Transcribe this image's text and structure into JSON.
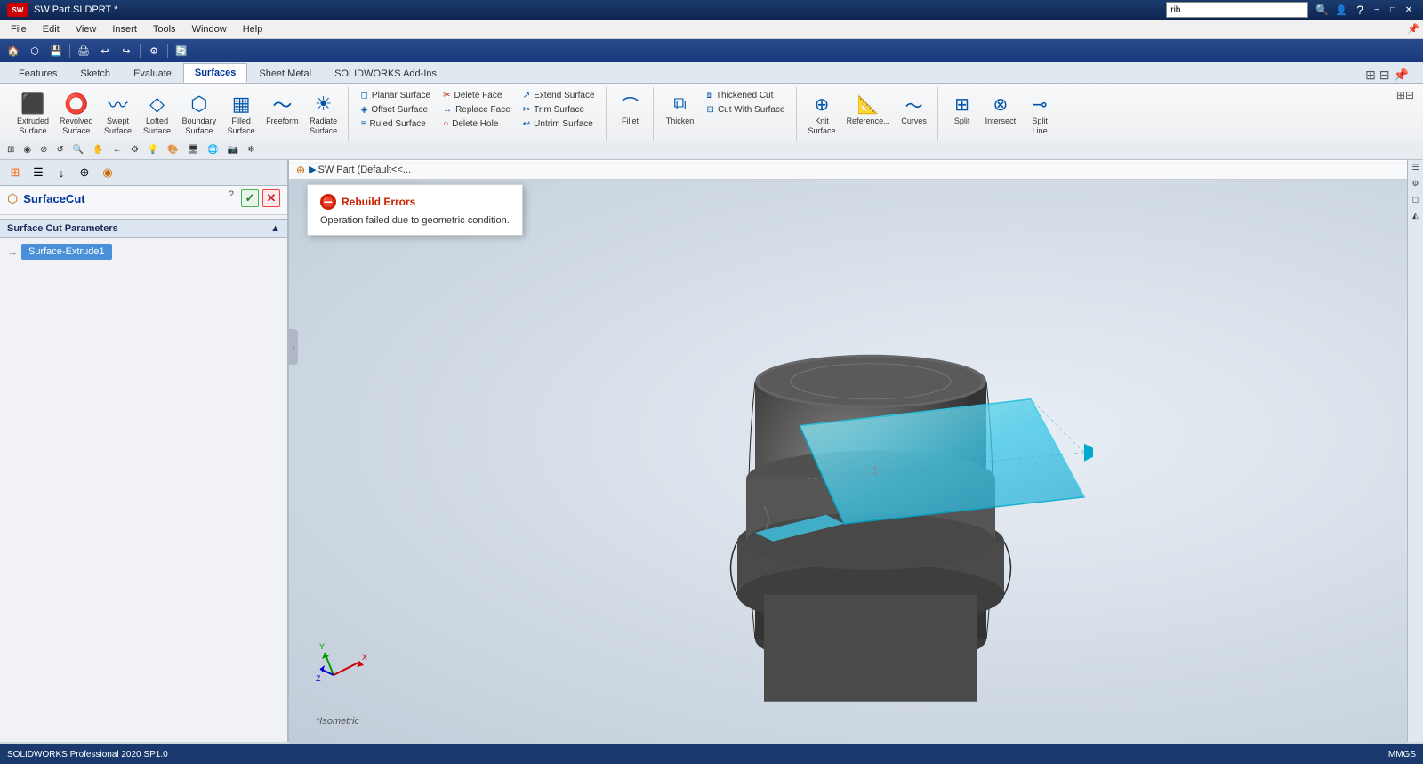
{
  "titlebar": {
    "title": "SW Part.SLDPRT *",
    "search_placeholder": "rib",
    "minimize": "−",
    "maximize": "□",
    "close": "✕"
  },
  "menubar": {
    "items": [
      "File",
      "Edit",
      "View",
      "Insert",
      "Tools",
      "Window",
      "Help"
    ]
  },
  "ribbon": {
    "tabs": [
      "Features",
      "Sketch",
      "Evaluate",
      "Surfaces",
      "Sheet Metal",
      "SOLIDWORKS Add-Ins"
    ],
    "active_tab": "Surfaces",
    "groups": {
      "create": {
        "buttons": [
          {
            "label": "Extruded\nSurface",
            "icon": "⬛"
          },
          {
            "label": "Revolved\nSurface",
            "icon": "🔄"
          },
          {
            "label": "Swept\nSurface",
            "icon": "〰"
          },
          {
            "label": "Lofted\nSurface",
            "icon": "◇"
          },
          {
            "label": "Boundary\nSurface",
            "icon": "⬡"
          },
          {
            "label": "Filled\nSurface",
            "icon": "▦"
          },
          {
            "label": "Freeform",
            "icon": "〜"
          },
          {
            "label": "Radiate\nSurface",
            "icon": "☀"
          }
        ]
      }
    },
    "surface_tools": [
      "Planar Surface",
      "Offset Surface",
      "Ruled Surface",
      "Delete Face",
      "Replace Face",
      "Delete Hole",
      "Extend Surface",
      "Trim Surface",
      "Untrim Surface"
    ],
    "other_tools": [
      "Fillet",
      "Thicken",
      "Thickened Cut",
      "Cut With Surface",
      "Knit Surface",
      "Reference...",
      "Curves",
      "Split",
      "Intersect",
      "Split Line"
    ]
  },
  "panel": {
    "tools": [
      "⊞",
      "☰",
      "↓",
      "⊕",
      "◉"
    ],
    "feature_name": "SurfaceCut",
    "help_icon": "?",
    "ok_label": "✓",
    "cancel_label": "✕",
    "section_title": "Surface Cut Parameters",
    "selection_label": "Surface-Extrude1",
    "selection_icon": "→"
  },
  "error": {
    "title": "Rebuild Errors",
    "message": "Operation failed due to geometric condition.",
    "icon": "●"
  },
  "feature_tree": {
    "item": "SW Part  (Default<<..."
  },
  "viewport": {
    "view_label": "*Isometric"
  },
  "statusbar": {
    "left": "SOLIDWORKS Professional 2020 SP1.0",
    "right": "MMGS"
  },
  "right_sidebar": {
    "buttons": [
      "◫",
      "☰",
      "⚙",
      "◻",
      "◭"
    ]
  },
  "toolbar_items": [
    "🏠",
    "⬡",
    "⬡",
    "⬡",
    "⬛",
    "⬛",
    "⬡",
    "⬛",
    "⬡",
    "⬡",
    "📷",
    "⬡",
    "⬡",
    "⬡",
    "⬡",
    "⬡",
    "⬡",
    "⬡",
    "⬡",
    "⬡"
  ]
}
